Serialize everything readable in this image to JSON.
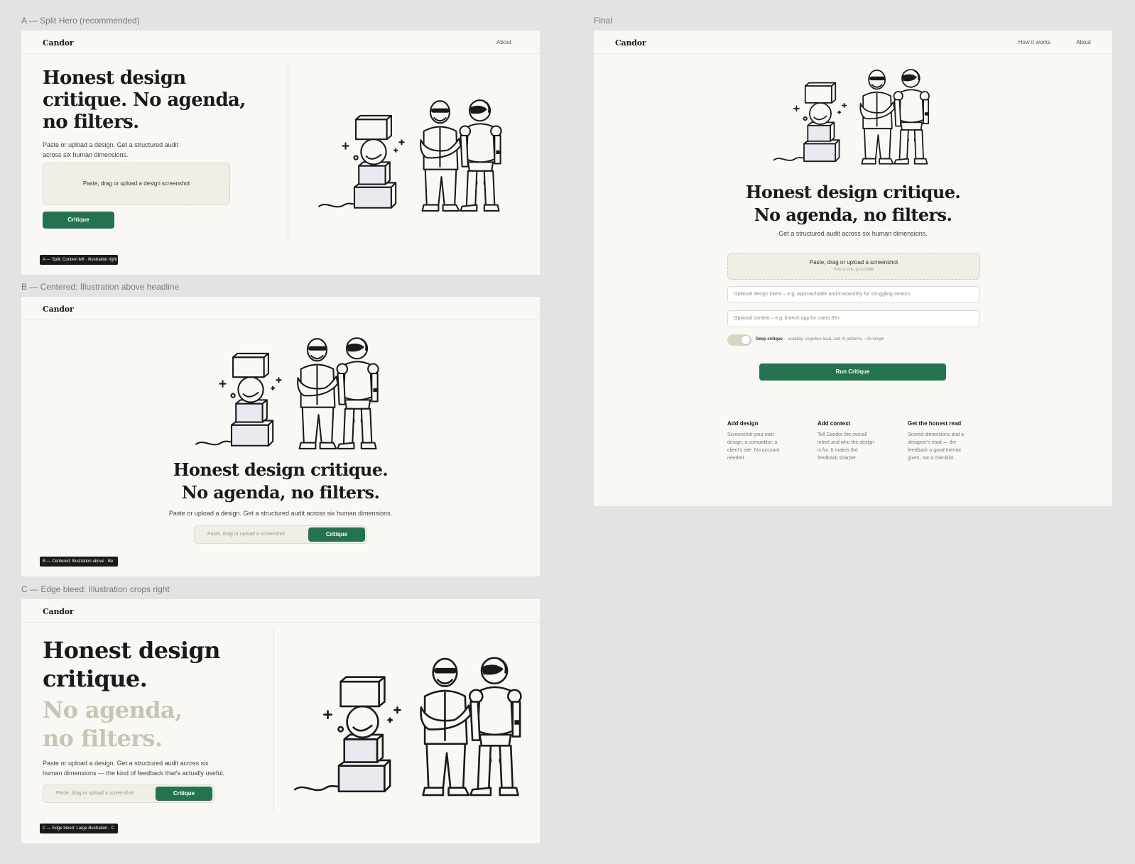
{
  "brand": "Candor",
  "labels": {
    "a": "A — Split Hero (recommended)",
    "b": "B — Centered: Illustration above headline",
    "c": "C — Edge bleed: Illustration crops right",
    "final": "Final"
  },
  "frame_a": {
    "nav_about": "About",
    "headline_1": "Honest design",
    "headline_2": "critique. No agenda,",
    "headline_3": "no filters.",
    "sub_1": "Paste or upload a design. Get a structured audit",
    "sub_2": "across six human dimensions.",
    "dropzone": "Paste, drag or upload a design screenshot",
    "button": "Critique",
    "caption": "A — Split: Content left · Illustration right"
  },
  "frame_b": {
    "headline_1": "Honest design critique.",
    "headline_2": "No agenda, no filters.",
    "sub": "Paste or upload a design. Get a structured audit across six human dimensions.",
    "input_placeholder": "Paste, drag or upload a screenshot",
    "button": "Critique",
    "caption": "B — Centered: Illustration above · Be"
  },
  "frame_c": {
    "headline_1": "Honest design",
    "headline_2": "critique.",
    "muted_1": "No agenda,",
    "muted_2": "no filters.",
    "sub_1": "Paste or upload a design. Get a structured audit across six",
    "sub_2": "human dimensions — the kind of feedback that's actually useful.",
    "input_placeholder": "Paste, drag or upload a screenshot",
    "button": "Critique",
    "caption": "C — Edge bleed: Large illustration · C"
  },
  "final": {
    "nav_how": "How it works",
    "nav_about": "About",
    "headline_1": "Honest design critique.",
    "headline_2": "No agenda, no filters.",
    "sub": "Get a structured audit across six human dimensions.",
    "dropzone": "Paste, drag or upload a screenshot",
    "dropzone_hint": "PNG or JPG, up to 10MB",
    "intent_placeholder": "Optional design intent – e.g. approachable and trustworthy for struggling seniors",
    "context_placeholder": "Optional context – e.g. fintech app for users 55+",
    "toggle_label": "Deep critique",
    "toggle_desc": " – usability, cognitive load, and AI patterns, ~2x longer",
    "toggle_on": true,
    "button": "Run Critique",
    "steps": [
      {
        "title": "Add design",
        "lines": [
          "Screenshot your own",
          "design, a competitor, a",
          "client's site. No account",
          "needed."
        ]
      },
      {
        "title": "Add context",
        "lines": [
          "Tell Candor the overall",
          "intent and who the design",
          "is for. It makes the",
          "feedback sharper."
        ]
      },
      {
        "title": "Get the honest read",
        "lines": [
          "Scored dimensions and a",
          "designer's read — the",
          "feedback a good mentor",
          "gives, not a checklist."
        ]
      }
    ]
  },
  "colors": {
    "accent": "#23734f",
    "canvas": "#e3e3e3",
    "frame_bg": "#f9f8f5",
    "dropzone_bg": "#f1eee6",
    "muted_headline": "#c9c4b6"
  },
  "icons": [
    "blocks-stack-illustration",
    "human-with-sunglasses-illustration",
    "robot-illustration"
  ]
}
